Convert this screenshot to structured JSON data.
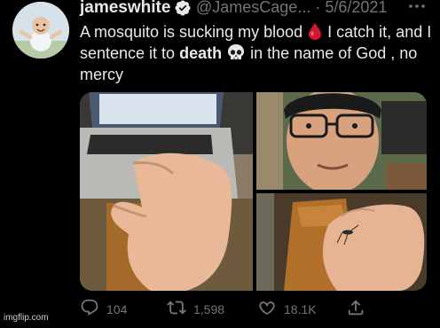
{
  "tweet": {
    "display_name": "jameswhite",
    "handle_date": "@JamesCage... · 5/6/2021",
    "text_part1": "A mosquito is sucking my blood",
    "text_part2": "I catch it, and I sentence it to",
    "text_bold": "death",
    "text_part3": "in the name of God , no mercy",
    "icons": {
      "verified": "verified-badge-icon",
      "more": "more-options-icon",
      "emoji1": "blood-drop-emoji",
      "emoji2": "skull-emoji"
    }
  },
  "actions": {
    "replies": "104",
    "retweets": "1,598",
    "likes": "18.1K",
    "share_icon": "share-icon"
  },
  "watermark": "imgflip.com",
  "colors": {
    "background": "#000000",
    "text_primary": "#e7e9ea",
    "text_secondary": "#71767b",
    "verified": "#e7e9ea",
    "blood": "#d3172e"
  }
}
